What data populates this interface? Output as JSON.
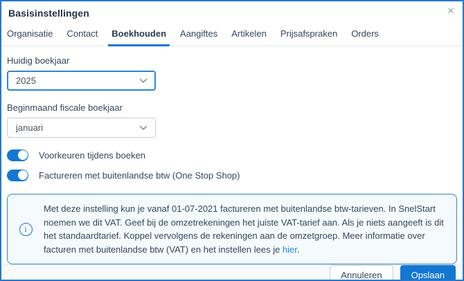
{
  "dialog": {
    "title": "Basisinstellingen",
    "close_icon": "✕"
  },
  "tabs": [
    {
      "label": "Organisatie",
      "active": false
    },
    {
      "label": "Contact",
      "active": false
    },
    {
      "label": "Boekhouden",
      "active": true
    },
    {
      "label": "Aangiftes",
      "active": false
    },
    {
      "label": "Artikelen",
      "active": false
    },
    {
      "label": "Prijsafspraken",
      "active": false
    },
    {
      "label": "Orders",
      "active": false
    }
  ],
  "form": {
    "fiscal_year": {
      "label": "Huidig boekjaar",
      "value": "2025"
    },
    "start_month": {
      "label": "Beginmaand fiscale boekjaar",
      "value": "januari"
    },
    "toggles": [
      {
        "label": "Voorkeuren tijdens boeken",
        "on": true
      },
      {
        "label": "Factureren met buitenlandse btw (One Stop Shop)",
        "on": true
      }
    ]
  },
  "info_box": {
    "icon_glyph": "i",
    "text_before_link": "Met deze instelling kun je vanaf 01-07-2021 factureren met buitenlandse btw-tarieven. In SnelStart noemen we dit VAT. Geef bij de omzetrekeningen het juiste VAT-tarief aan. Als je niets aangeeft is dit het standaardtarief. Koppel vervolgens de rekeningen aan de omzetgroep. Meer informatie over facturen met buitenlandse btw (VAT) en het instellen lees je ",
    "link_text": "hier",
    "text_after_link": "."
  },
  "footer": {
    "cancel_label": "Annuleren",
    "save_label": "Opslaan"
  },
  "colors": {
    "accent_blue": "#1377d3",
    "dialog_border_blue": "#2878c8",
    "focused_select_border": "#2e86d1",
    "info_box_border": "#2e86d1",
    "info_box_background": "#f5fafd",
    "link_blue": "#1e88e5",
    "text_dark": "#33475b",
    "footer_background": "#f8f9fa"
  }
}
